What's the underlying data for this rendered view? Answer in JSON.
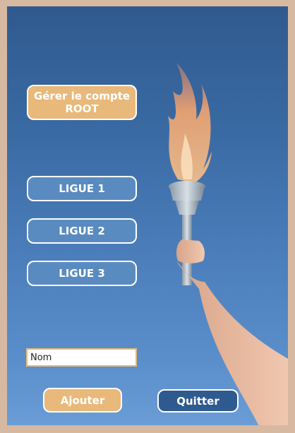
{
  "menu": {
    "root_label": "Gérer le compte ROOT",
    "ligue_labels": [
      "LIGUE 1",
      "LIGUE 2",
      "LIGUE 3"
    ]
  },
  "form": {
    "name_value": "Nom",
    "add_label": "Ajouter",
    "quit_label": "Quitter"
  },
  "colors": {
    "accent_orange": "#e8b97a",
    "button_blue": "#5a8bc0",
    "dark_blue": "#2f5a8f",
    "frame_border": "#d6b9a0"
  }
}
